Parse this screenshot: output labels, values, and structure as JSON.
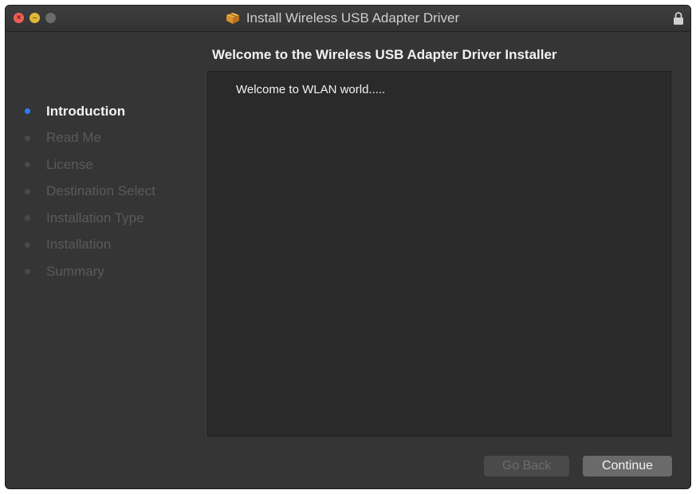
{
  "window": {
    "title": "Install Wireless USB Adapter Driver",
    "icons": {
      "close": "close-icon",
      "minimize": "minimize-icon",
      "zoom": "zoom-icon",
      "package": "package-icon",
      "lock": "lock-icon"
    }
  },
  "header": {
    "heading": "Welcome to the Wireless USB Adapter Driver Installer"
  },
  "sidebar": {
    "steps": [
      {
        "label": "Introduction",
        "active": true
      },
      {
        "label": "Read Me",
        "active": false
      },
      {
        "label": "License",
        "active": false
      },
      {
        "label": "Destination Select",
        "active": false
      },
      {
        "label": "Installation Type",
        "active": false
      },
      {
        "label": "Installation",
        "active": false
      },
      {
        "label": "Summary",
        "active": false
      }
    ]
  },
  "content": {
    "text": "Welcome to WLAN world....."
  },
  "buttons": {
    "back": "Go Back",
    "continue": "Continue"
  },
  "colors": {
    "accent": "#2f7cf6",
    "close": "#ec5f57",
    "minimize": "#e0b73a",
    "window_bg": "#353535",
    "content_bg": "#2a2a2a"
  }
}
